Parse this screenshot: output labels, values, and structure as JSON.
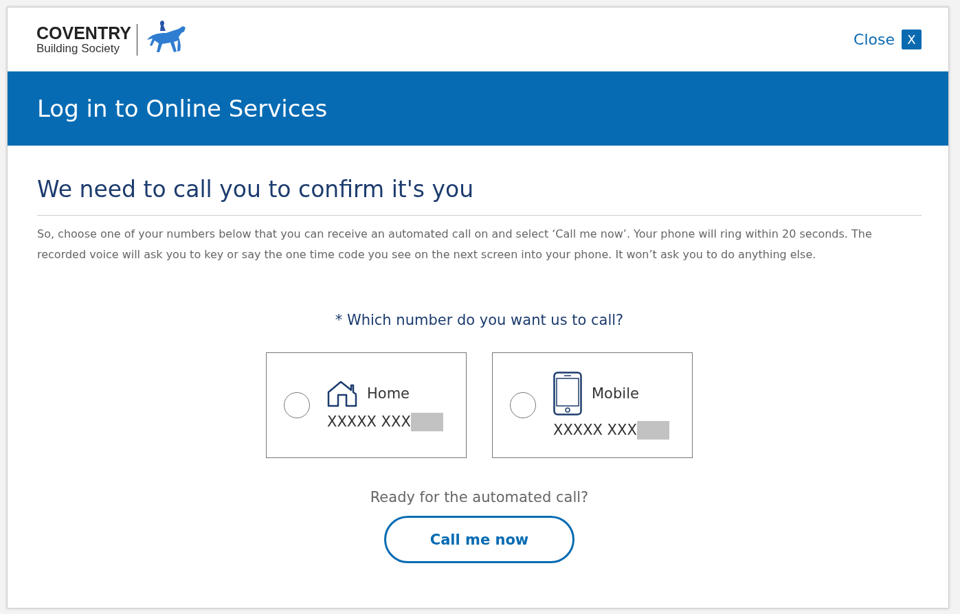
{
  "logo": {
    "name": "COVENTRY",
    "subtitle": "Building Society"
  },
  "close": {
    "label": "Close",
    "icon": "X"
  },
  "banner": {
    "title": "Log in to Online Services"
  },
  "heading": "We need to call you to confirm it's you",
  "intro": "So, choose one of your numbers below that you can receive an automated call on and select ‘Call me now’. Your phone will ring within 20 seconds. The recorded voice will ask you to key or say the one time code you see on the next screen into your phone. It won’t ask you to do anything else.",
  "question": "* Which number do you want us to call?",
  "options": [
    {
      "kind": "home",
      "label": "Home",
      "number": "XXXXX XXX",
      "selected": false
    },
    {
      "kind": "mobile",
      "label": "Mobile",
      "number": "XXXXX XXX",
      "selected": false
    }
  ],
  "prompt": "Ready for the automated call?",
  "button": "Call me now"
}
